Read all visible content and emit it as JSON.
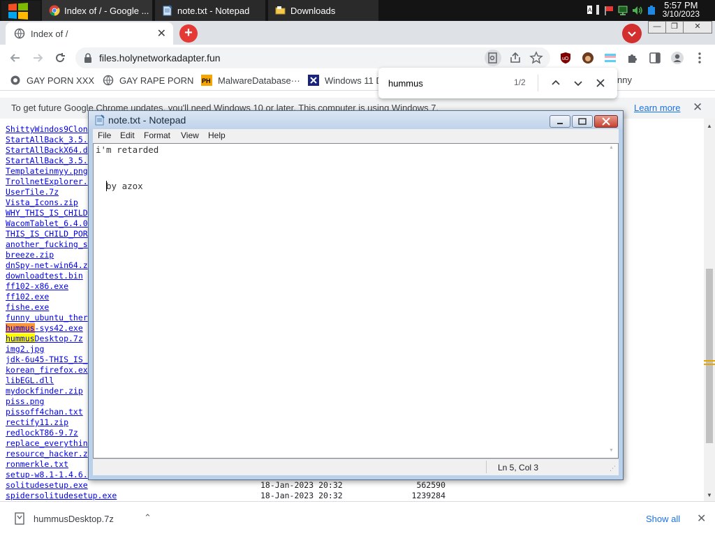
{
  "taskbar": {
    "tabs": [
      {
        "label": "Index of / - Google ...",
        "icon": "chrome-icon"
      },
      {
        "label": "note.txt - Notepad",
        "icon": "notepad-icon"
      },
      {
        "label": "Downloads",
        "icon": "folder-icon"
      }
    ],
    "clock_time": "5:57 PM",
    "clock_date": "3/10/2023"
  },
  "browser": {
    "tab_title": "Index of /",
    "url": "files.holynetworkadapter.fun",
    "bookmarks": [
      {
        "label": "GAY PORN XXX",
        "icon": "bookmark-globe-icon"
      },
      {
        "label": "GAY RAPE PORN",
        "icon": "bookmark-globe-icon"
      },
      {
        "label": "MalwareDatabase···",
        "icon": "ph-icon"
      },
      {
        "label": "Windows 11 D",
        "icon": "x-icon"
      },
      {
        "label": "nny",
        "icon": ""
      }
    ],
    "find": {
      "query": "hummus",
      "count": "1/2"
    },
    "infobar": {
      "text": "To get future Google Chrome updates, you'll need Windows 10 or later. This computer is using Windows 7.",
      "link": "Learn more"
    },
    "accent_color": "#d32f2f"
  },
  "listing": {
    "rows": [
      {
        "name": "ShittyWindos9Clon",
        "date": "",
        "size": ""
      },
      {
        "name": "StartAllBack_3.5.",
        "date": "",
        "size": ""
      },
      {
        "name": "StartAllBackX64.d",
        "date": "",
        "size": ""
      },
      {
        "name": "StartAllBack_3.5.",
        "date": "",
        "size": ""
      },
      {
        "name": "Templateinmyy.png",
        "date": "",
        "size": ""
      },
      {
        "name": "TrollnetExplorer.",
        "date": "",
        "size": ""
      },
      {
        "name": "UserTile.7z",
        "date": "",
        "size": ""
      },
      {
        "name": "Vista_Icons.zip",
        "date": "",
        "size": ""
      },
      {
        "name": "WHY_THIS_IS_CHILD",
        "date": "",
        "size": ""
      },
      {
        "name": "WacomTablet_6.4.0",
        "date": "",
        "size": ""
      },
      {
        "name": "THIS_IS_CHILD_POR",
        "date": "",
        "size": ""
      },
      {
        "name": "another_fucking_s",
        "date": "",
        "size": ""
      },
      {
        "name": "breeze.zip",
        "date": "",
        "size": ""
      },
      {
        "name": "dnSpy-net-win64.z",
        "date": "",
        "size": ""
      },
      {
        "name": "downloadtest.bin",
        "date": "",
        "size": ""
      },
      {
        "name": "ff102-x86.exe",
        "date": "",
        "size": ""
      },
      {
        "name": "ff102.exe",
        "date": "",
        "size": ""
      },
      {
        "name": "fishe.exe",
        "date": "",
        "size": ""
      },
      {
        "name": "funny_ubuntu_ther",
        "date": "",
        "size": ""
      },
      {
        "name": "hummus-sys42.exe",
        "date": "",
        "size": "",
        "hl_len": 6,
        "hl": "current"
      },
      {
        "name": "hummusDesktop.7z",
        "date": "",
        "size": "",
        "hl_len": 6,
        "hl": "match"
      },
      {
        "name": "img2.jpg",
        "date": "",
        "size": ""
      },
      {
        "name": "jdk-6u45-THIS_IS_",
        "date": "",
        "size": ""
      },
      {
        "name": "korean_firefox.ex",
        "date": "",
        "size": ""
      },
      {
        "name": "libEGL.dll",
        "date": "",
        "size": ""
      },
      {
        "name": "mydockfinder.zip",
        "date": "",
        "size": ""
      },
      {
        "name": "piss.png",
        "date": "",
        "size": ""
      },
      {
        "name": "pissoff4chan.txt",
        "date": "",
        "size": ""
      },
      {
        "name": "rectify11.zip",
        "date": "",
        "size": ""
      },
      {
        "name": "redlockT86-9.7z",
        "date": "",
        "size": ""
      },
      {
        "name": "replace_everythin",
        "date": "",
        "size": ""
      },
      {
        "name": "resource_hacker.z",
        "date": "",
        "size": ""
      },
      {
        "name": "ronmerkle.txt",
        "date": "",
        "size": ""
      },
      {
        "name": "setup-w8.1-1.4.6.",
        "date": "",
        "size": ""
      },
      {
        "name": "solitudesetup.exe",
        "date": "18-Jan-2023 20:32",
        "size": "562590"
      },
      {
        "name": "spidersolitudesetup.exe",
        "date": "18-Jan-2023 20:32",
        "size": "1239284"
      }
    ]
  },
  "notepad": {
    "title": "note.txt - Notepad",
    "menu": [
      "File",
      "Edit",
      "Format",
      "View",
      "Help"
    ],
    "line1": "i'm retarded",
    "line2": "by azox",
    "status": "Ln 5, Col 3"
  },
  "downloads": {
    "file": "hummusDesktop.7z",
    "show_all": "Show all"
  }
}
